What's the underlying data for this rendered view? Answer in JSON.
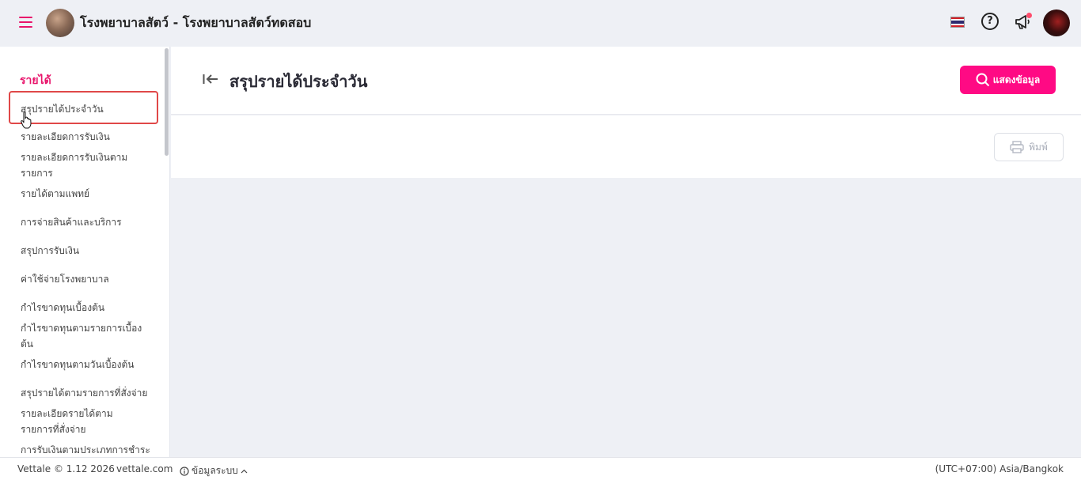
{
  "header": {
    "app_title": "โรงพยาบาลสัตว์ - โรงพยาบาลสัตว์ทดสอบ",
    "help_glyph": "?"
  },
  "sidebar": {
    "section_title": "รายได้",
    "items": [
      {
        "label": "สรุปรายได้ประจำวัน",
        "active": true
      },
      {
        "label": "รายละเอียดการรับเงิน"
      },
      {
        "label": "รายละเอียดการรับเงินตามรายการ"
      },
      {
        "label": "รายได้ตามแพทย์"
      },
      {
        "label": "การจ่ายสินค้าและบริการ"
      },
      {
        "label": "สรุปการรับเงิน"
      },
      {
        "label": "ค่าใช้จ่ายโรงพยาบาล"
      },
      {
        "label": "กำไรขาดทุนเบื้องต้น"
      },
      {
        "label": "กำไรขาดทุนตามรายการเบื้องต้น"
      },
      {
        "label": "กำไรขาดทุนตามวันเบื้องต้น"
      },
      {
        "label": "สรุปรายได้ตามรายการที่สั่งจ่าย"
      },
      {
        "label": "รายละเอียดรายได้ตามรายการที่สั่งจ่าย"
      },
      {
        "label": "การรับเงินตามประเภทการชำระ"
      }
    ]
  },
  "main": {
    "page_title": "สรุปรายได้ประจำวัน",
    "show_button": "แสดงข้อมูล",
    "print_button": "พิมพ์"
  },
  "footer": {
    "version": "Vettale © 1.12 2026",
    "site": "vettale.com",
    "system_info": "ข้อมูลระบบ",
    "timezone": "(UTC+07:00) Asia/Bangkok"
  },
  "colors": {
    "accent": "#e8146b",
    "button": "#ff0a84",
    "highlight_border": "#e04848"
  }
}
